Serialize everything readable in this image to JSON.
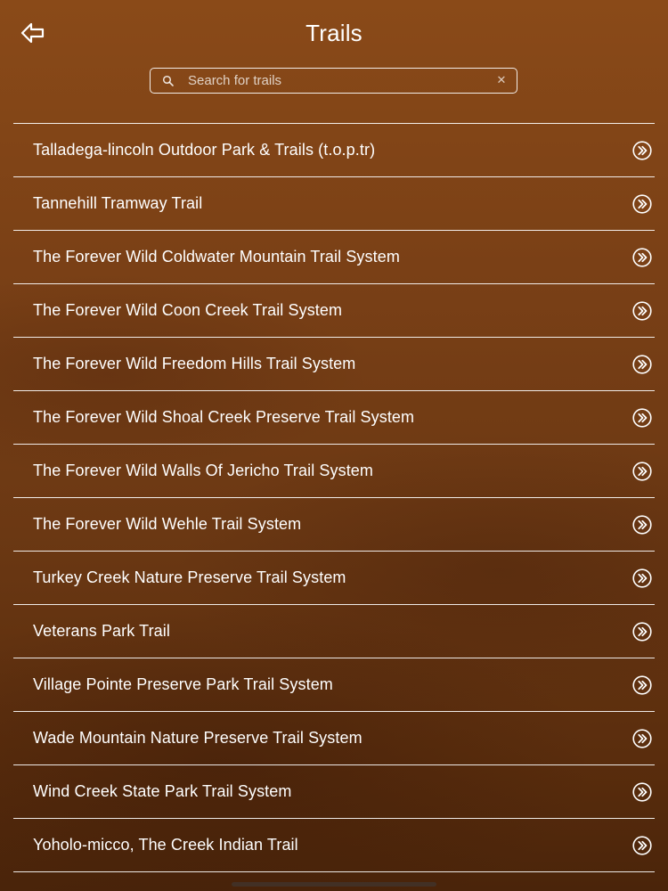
{
  "header": {
    "title": "Trails",
    "back_icon": "back-arrow-icon"
  },
  "search": {
    "placeholder": "Search for trails",
    "value": "",
    "icon": "search-icon",
    "clear_label": "✕"
  },
  "trails": [
    {
      "name": "Talladega-lincoln Outdoor Park & Trails (t.o.p.tr)"
    },
    {
      "name": "Tannehill Tramway Trail"
    },
    {
      "name": "The Forever Wild Coldwater Mountain Trail System"
    },
    {
      "name": "The Forever Wild Coon Creek Trail System"
    },
    {
      "name": "The Forever Wild Freedom Hills Trail System"
    },
    {
      "name": "The Forever Wild Shoal Creek Preserve Trail System"
    },
    {
      "name": "The Forever Wild Walls Of Jericho Trail System"
    },
    {
      "name": "The Forever Wild Wehle Trail System"
    },
    {
      "name": "Turkey Creek Nature Preserve Trail System"
    },
    {
      "name": "Veterans Park Trail"
    },
    {
      "name": "Village Pointe Preserve Park Trail System"
    },
    {
      "name": "Wade Mountain Nature Preserve Trail System"
    },
    {
      "name": "Wind Creek State Park Trail System"
    },
    {
      "name": "Yoholo-micco, The Creek Indian Trail"
    }
  ],
  "item_icon": "chevron-right-circle-icon",
  "colors": {
    "background_top": "#8a4a18",
    "background_bottom": "#4a240a",
    "text": "#ffffff"
  }
}
